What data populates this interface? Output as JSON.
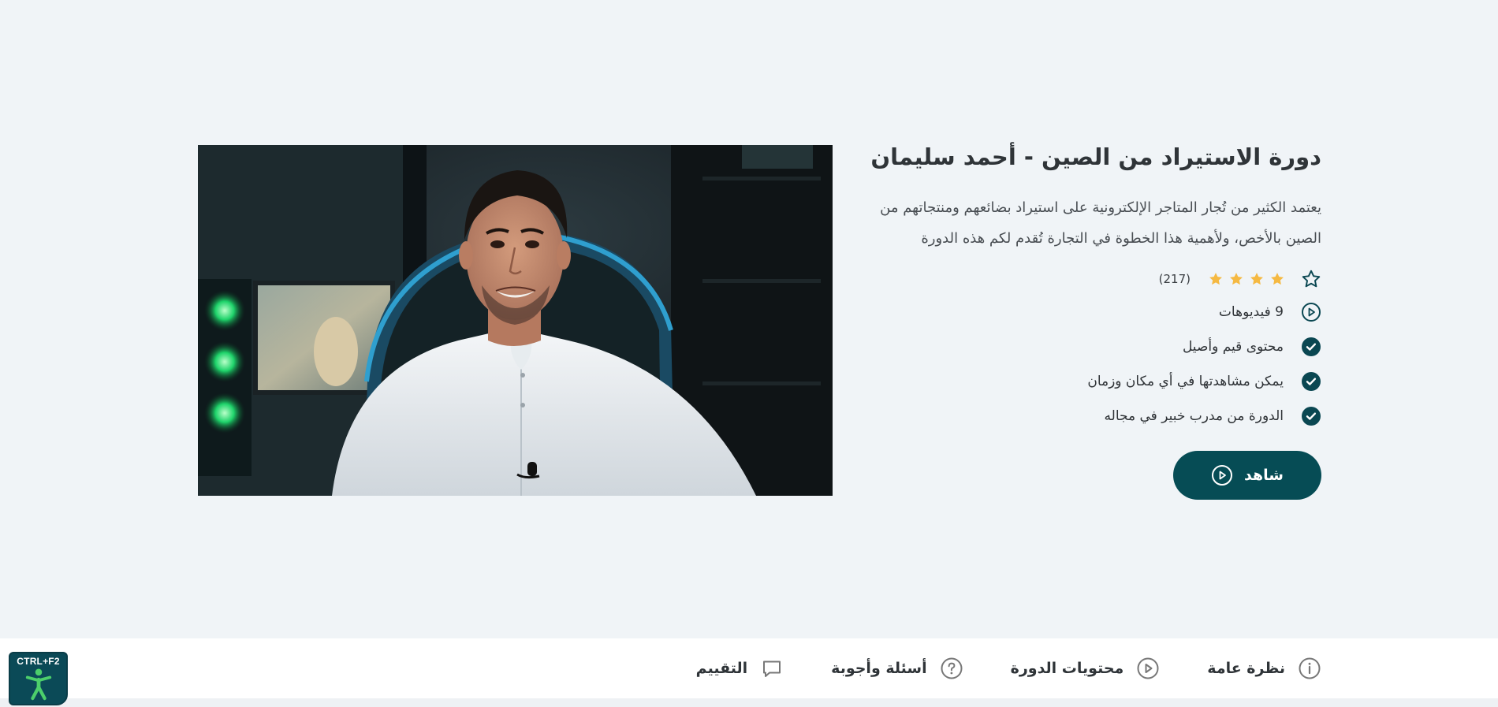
{
  "course": {
    "title": "دورة الاستيراد من الصين - أحمد سليمان",
    "description": "يعتمد الكثير من تُجار المتاجر الإلكترونية على استيراد بضائعهم ومنتجاتهم من الصين بالأخص، ولأهمية هذا الخطوة في التجارة تُقدم لكم هذه الدورة",
    "rating": {
      "stars": 4,
      "count": "(217)"
    },
    "features": [
      {
        "icon": "play-circle-icon",
        "text": "9 فيديوهات"
      },
      {
        "icon": "check-circle-icon",
        "text": "محتوى قيم وأصيل"
      },
      {
        "icon": "check-circle-icon",
        "text": "يمكن مشاهدتها في أي مكان وزمان"
      },
      {
        "icon": "check-circle-icon",
        "text": "الدورة من مدرب خبير في مجاله"
      }
    ],
    "watch_label": "شاهد"
  },
  "tabs": [
    {
      "icon": "info-icon",
      "label": "نظرة عامة"
    },
    {
      "icon": "play-circle-icon",
      "label": "محتويات الدورة"
    },
    {
      "icon": "question-icon",
      "label": "أسئلة وأجوبة"
    },
    {
      "icon": "comment-icon",
      "label": "التقييم"
    }
  ],
  "accessibility": {
    "shortcut": "CTRL+F2"
  },
  "colors": {
    "accent": "#064c55",
    "star": "#f5b942",
    "background": "#f0f4f7"
  }
}
